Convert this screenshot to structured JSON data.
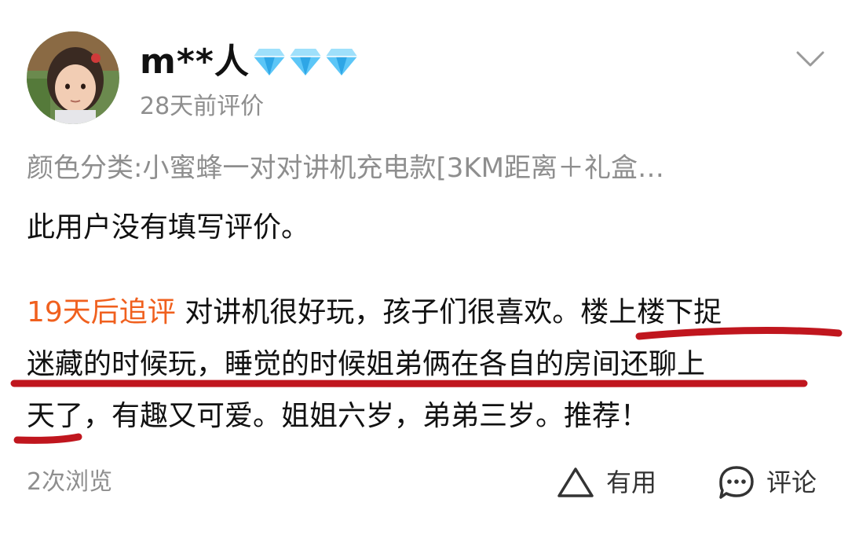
{
  "user": {
    "name": "m**人",
    "review_time": "28天前评价",
    "badge_icons": [
      "diamond-icon",
      "diamond-icon",
      "diamond-icon"
    ],
    "badge_color": "#3db4f2"
  },
  "review": {
    "sku": "颜色分类:小蜜蜂一对对讲机充电款[3KM距离＋礼盒…",
    "initial_text": "此用户没有填写评价。",
    "followup_tag": "19天后追评",
    "followup_tag_color": "#f0601e",
    "followup_lines": [
      "对讲机很好玩，孩子们很喜欢。楼上楼下捉",
      "迷藏的时候玩，睡觉的时候姐弟俩在各自的房间还聊上",
      "天了，有趣又可爱。姐姐六岁，弟弟三岁。推荐！"
    ],
    "annotation_color": "#c0161e"
  },
  "footer": {
    "view_count": "2次浏览",
    "helpful_label": "有用",
    "comment_label": "评论"
  },
  "icons": {
    "collapse": "chevron-down-icon",
    "helpful": "triangle-icon",
    "comment": "chat-bubble-icon"
  }
}
